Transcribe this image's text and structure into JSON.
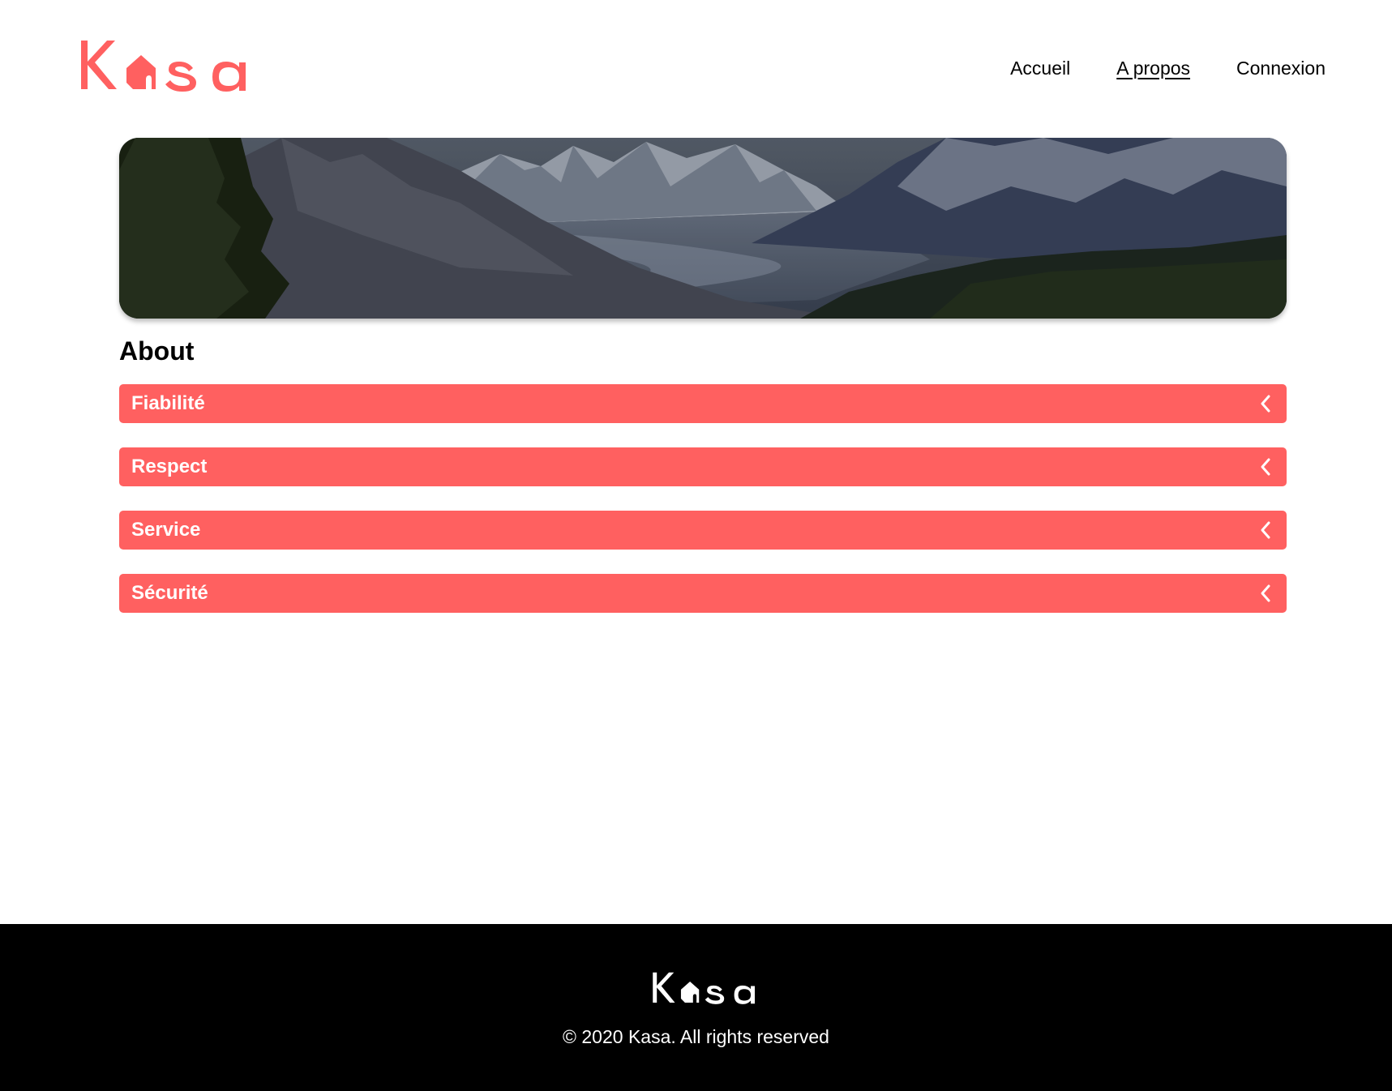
{
  "brand": {
    "name": "Kasa",
    "accent_color": "#ff6060"
  },
  "nav": {
    "items": [
      {
        "label": "Accueil",
        "active": false
      },
      {
        "label": "A propos",
        "active": true
      },
      {
        "label": "Connexion",
        "active": false
      }
    ]
  },
  "banner": {
    "description_icon": "mountain-landscape-image"
  },
  "main": {
    "title": "About",
    "sections": [
      {
        "label": "Fiabilité",
        "icon": "chevron-left-icon",
        "expanded": false
      },
      {
        "label": "Respect",
        "icon": "chevron-left-icon",
        "expanded": false
      },
      {
        "label": "Service",
        "icon": "chevron-left-icon",
        "expanded": false
      },
      {
        "label": "Sécurité",
        "icon": "chevron-left-icon",
        "expanded": false
      }
    ]
  },
  "footer": {
    "copyright": "© 2020 Kasa. All rights reserved",
    "background": "#000000"
  }
}
